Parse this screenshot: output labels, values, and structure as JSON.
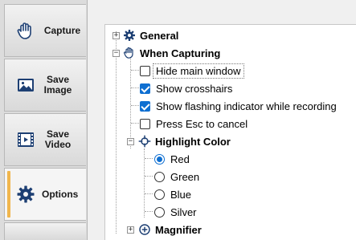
{
  "sidebar": {
    "tabs": [
      {
        "label": "Capture",
        "icon": "hand-icon",
        "active": false
      },
      {
        "label": "Save Image",
        "icon": "image-icon",
        "active": false
      },
      {
        "label": "Save Video",
        "icon": "film-icon",
        "active": false
      },
      {
        "label": "Options",
        "icon": "gear-icon",
        "active": true
      }
    ]
  },
  "tree": {
    "general": {
      "label": "General",
      "expanded": false
    },
    "when_capturing": {
      "label": "When Capturing",
      "expanded": true,
      "options": [
        {
          "label": "Hide main window",
          "checked": false
        },
        {
          "label": "Show crosshairs",
          "checked": true
        },
        {
          "label": "Show flashing indicator while recording",
          "checked": true
        },
        {
          "label": "Press Esc to cancel",
          "checked": false
        }
      ],
      "highlight_color": {
        "label": "Highlight Color",
        "expanded": true,
        "choices": [
          {
            "label": "Red",
            "selected": true
          },
          {
            "label": "Green",
            "selected": false
          },
          {
            "label": "Blue",
            "selected": false
          },
          {
            "label": "Silver",
            "selected": false
          }
        ]
      },
      "magnifier": {
        "label": "Magnifier",
        "expanded": false
      }
    }
  },
  "colors": {
    "accent": "#0f6fd1",
    "tab_indicator": "#f0b64d"
  }
}
